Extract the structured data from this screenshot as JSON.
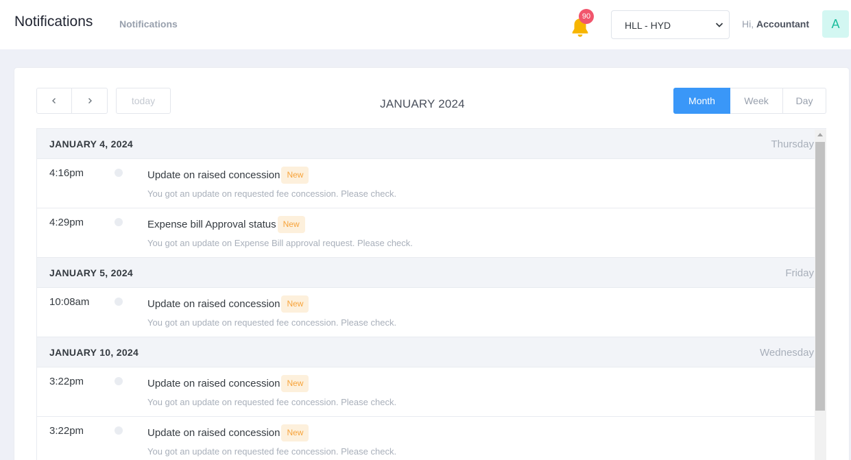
{
  "header": {
    "title": "Notifications",
    "breadcrumb": "Notifications",
    "notification_count": "90",
    "branch_selected": "HLL - HYD",
    "greeting_prefix": "Hi,",
    "user_name": "Accountant",
    "avatar_initial": "A"
  },
  "icons": {
    "bell": "bell-icon",
    "prev": "chevron-left-icon",
    "next": "chevron-right-icon",
    "select": "chevron-down-icon"
  },
  "colors": {
    "accent": "#3a97f8",
    "badge_bg": "#fdf0dc",
    "badge_text": "#f7a33a",
    "notification_badge": "#f1556c",
    "bell": "#f7b500",
    "avatar_bg": "#d3f7f2",
    "avatar_text": "#1abc9c"
  },
  "calendar": {
    "today_label": "today",
    "title": "JANUARY 2024",
    "views": [
      {
        "label": "Month",
        "active": true
      },
      {
        "label": "Week",
        "active": false
      },
      {
        "label": "Day",
        "active": false
      }
    ]
  },
  "days": [
    {
      "date": "JANUARY 4, 2024",
      "weekday": "Thursday",
      "events": [
        {
          "time": "4:16pm",
          "title": "Update on raised concession",
          "badge": "New",
          "description": "You got an update on requested fee concession. Please check."
        },
        {
          "time": "4:29pm",
          "title": "Expense bill Approval status",
          "badge": "New",
          "description": "You got an update on Expense Bill approval request. Please check."
        }
      ]
    },
    {
      "date": "JANUARY 5, 2024",
      "weekday": "Friday",
      "events": [
        {
          "time": "10:08am",
          "title": "Update on raised concession",
          "badge": "New",
          "description": "You got an update on requested fee concession. Please check."
        }
      ]
    },
    {
      "date": "JANUARY 10, 2024",
      "weekday": "Wednesday",
      "events": [
        {
          "time": "3:22pm",
          "title": "Update on raised concession",
          "badge": "New",
          "description": "You got an update on requested fee concession. Please check."
        },
        {
          "time": "3:22pm",
          "title": "Update on raised concession",
          "badge": "New",
          "description": "You got an update on requested fee concession. Please check."
        }
      ]
    }
  ]
}
